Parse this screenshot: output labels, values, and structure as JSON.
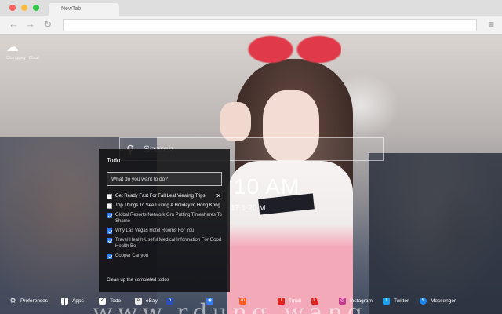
{
  "browser": {
    "tab_title": "NewTab"
  },
  "weather": {
    "location": "Chongqing · Cloud"
  },
  "search": {
    "placeholder": "Search"
  },
  "clock": {
    "time": "10 AM",
    "date": "17.1.20.M"
  },
  "todo": {
    "title": "Todo",
    "input_placeholder": "What do you want to do?",
    "items": [
      {
        "text": "Get Ready Fast For Fall Leaf Viewing Trips",
        "done": false
      },
      {
        "text": "Top Things To See During A Holiday In Hong Kong",
        "done": false
      },
      {
        "text": "Global Resorts Network Grn Putting Timeshares To Shame",
        "done": true
      },
      {
        "text": "Why Las Vegas Hotel Rooms For You",
        "done": true
      },
      {
        "text": "Travel Health Useful Medical Information For Good Health Be",
        "done": true
      },
      {
        "text": "Copper Canyon",
        "done": true
      }
    ],
    "clean_label": "Clean up the completed todos"
  },
  "watermark": "www.rdung.wang",
  "bottom_bar": {
    "items": [
      {
        "label": "Preferences",
        "icon": "gear-icon",
        "color": "#ffffff"
      },
      {
        "label": "Apps",
        "icon": "apps-grid-icon",
        "color": "#ffffff"
      },
      {
        "label": "Todo",
        "icon": "todo-check-icon",
        "color": "#ffffff"
      },
      {
        "label": "eBay",
        "icon": "ebay-icon",
        "color": "#e8e8e8"
      },
      {
        "label": "",
        "icon": "blue-app-icon",
        "color": "#2d4fb8"
      },
      {
        "label": "Tmall",
        "icon": "tmall-icon",
        "color": "#e0221e"
      },
      {
        "label": "Instagram",
        "icon": "instagram-icon",
        "color": "#c33a8e"
      },
      {
        "label": "Twitter",
        "icon": "twitter-icon",
        "color": "#1da1f2"
      },
      {
        "label": "Messenger",
        "icon": "messenger-icon",
        "color": "#1b86f0"
      }
    ]
  }
}
